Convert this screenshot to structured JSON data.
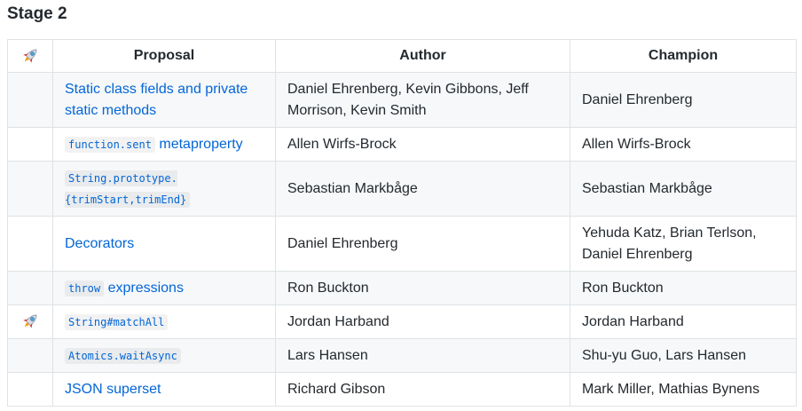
{
  "heading": "Stage 2",
  "table": {
    "headers": {
      "proposal": "Proposal",
      "author": "Author",
      "champion": "Champion"
    },
    "rows": [
      {
        "rocket": false,
        "proposal": {
          "code": "",
          "text": "Static class fields and private static methods"
        },
        "author": "Daniel Ehrenberg, Kevin Gibbons, Jeff Morrison, Kevin Smith",
        "champion": "Daniel Ehrenberg"
      },
      {
        "rocket": false,
        "proposal": {
          "code": "function.sent",
          "text": "metaproperty"
        },
        "author": "Allen Wirfs-Brock",
        "champion": "Allen Wirfs-Brock"
      },
      {
        "rocket": false,
        "proposal": {
          "code": "String.prototype.{trimStart,trimEnd}",
          "text": ""
        },
        "author": "Sebastian Markbåge",
        "champion": "Sebastian Markbåge"
      },
      {
        "rocket": false,
        "proposal": {
          "code": "",
          "text": "Decorators"
        },
        "author": "Daniel Ehrenberg",
        "champion": "Yehuda Katz, Brian Terlson, Daniel Ehrenberg"
      },
      {
        "rocket": false,
        "proposal": {
          "code": "throw",
          "text": "expressions"
        },
        "author": "Ron Buckton",
        "champion": "Ron Buckton"
      },
      {
        "rocket": true,
        "proposal": {
          "code": "String#matchAll",
          "text": ""
        },
        "author": "Jordan Harband",
        "champion": "Jordan Harband"
      },
      {
        "rocket": false,
        "proposal": {
          "code": "Atomics.waitAsync",
          "text": ""
        },
        "author": "Lars Hansen",
        "champion": "Shu-yu Guo, Lars Hansen"
      },
      {
        "rocket": false,
        "proposal": {
          "code": "",
          "text": "JSON superset"
        },
        "author": "Richard Gibson",
        "champion": "Mark Miller, Mathias Bynens"
      }
    ]
  },
  "icons": {
    "header": "rocket-icon",
    "row": "rocket-icon"
  },
  "colors": {
    "link": "#0366d6",
    "border": "#dfe2e5",
    "stripe": "#f6f8fa",
    "text": "#24292e"
  }
}
